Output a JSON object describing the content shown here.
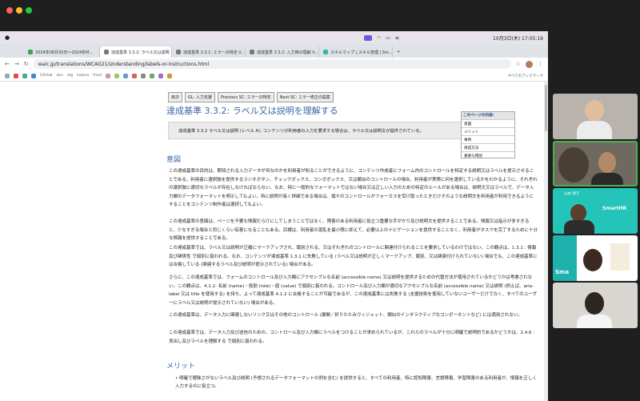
{
  "menubar": {
    "apple": "",
    "right_time": "10月3日(木) 17:05:19"
  },
  "tabs": [
    {
      "label": "2024年08月30日〜2024年M..."
    },
    {
      "label": "達成基準 3.3.2: ラベル又は説明"
    },
    {
      "label": "達成基準 3.3.1: エラーの特定 V..."
    },
    {
      "label": "達成基準 3.3.2: 入力時の理解 V..."
    },
    {
      "label": "スキルマップ | スキル管理 | Sm..."
    }
  ],
  "toolbar": {
    "url": "waic.jp/translations/WCAG21/Understanding/labels-or-instructions.html"
  },
  "bookmarks": {
    "items": [
      "GitHub",
      "dev",
      "otg",
      "kakuro",
      "front"
    ],
    "all": "すべてのブックマーク"
  },
  "nav": {
    "toc": "目次",
    "prev": "GL: 入力支援",
    "prev_sc": "Previous SC: エラーの特定",
    "next_sc": "Next SC: エラー修正の提案"
  },
  "page": {
    "title": "達成基準 3.3.2: ラベル又は説明を理解する",
    "summary": "達成基準 3.3.2 ラベル又は説明 (レベル A): コンテンツが利用者の入力を要求する場合は、ラベル又は説明文が提供されている。",
    "toc_title": "このページの内容:",
    "toc_items": [
      "意図",
      "メリット",
      "事例",
      "達成方法",
      "重要な用語"
    ],
    "intent_heading": "意図",
    "intent_p1": "この達成基準の目的は、期待される入力データが何なのかを利用者が知ることができるように、コンテンツ作成者にフォーム内のコントロールを特定する説明又はラベルを提示させることである。利用者に選択肢を提供するラジオボタン、チェックボックス、コンボボックス、又は類似のコントロールの場合、利用者が実際に何を選択しているかをわかるように、それぞれの選択肢に適切なラベルが存在しなければならない。なお、特に一般的なフォーマットではない場合又は正しい入力のための特定のルールがある場合は、説明文又はラベルで、データ入力欄のデータフォーマットを明示してもよい。特に説明が長く詳細である場合は、個々のコントロールがフォーカスを受け取ったときだけそのような説明文を利用者が利用できるようにすることをコンテンツ制作者は選択してもよい。",
    "intent_p2": "この達成基準の意図は、ページを不要な情報だらけにしてしまうことではなく、障害のある利用者に役立つ重要な手がかり及び説明文を提供することである。情報又は指示が多すぎると、少なすぎる場合と同じくらい有害になることもある。目標は、利用者の混乱を最小限に抑えて、必要以上のナビゲーションを提供することなく、利用者がタスクを完了するために十分な情報を提供することである。",
    "intent_p3": "この達成基準では、ラベル又は説明が正確にマークアップされ、識別される、又はそれぞれのコントロールに関連付けられることを要求しているわけではない。この観点は、1.3.1 : 情報及び関係性 で個別に扱われる。なお、コンテンツが達成基準 1.3.1 に失敗している (ラベル又は説明が正しくマークアップ、識別、又は関連付けられていない) 場合でも、この達成基準には合格している (関連するラベル及び説明が提示されている) 場合がある。",
    "intent_p4": "さらに、この達成基準では、フォームのコントロール及び入力欄にアクセシブルな名前 (accessible name) 又は説明を提供するための代替方法が使用されているかどうかは考慮されない。この観点は、4.1.2: 名前 (name)・役割 (role)・値 (value) で個別に扱われる。コントロール及び入力欄が適切なアクセシブルな名前 (accessible name) 又は説明 (例えば、aria-label 又は title を使用する) を持ち、よって達成基準 4.1.2 に合格することが可能であるが、この達成基準には失敗する (支援技術を使用していないユーザーだけでなく、すべてのユーザーにラベル又は説明が提示されていない) 場合がある。",
    "intent_p5": "この達成基準は、データ入力に関連しないリンク又はその他のコントロール (展開／折りたたみウィジェット、類似のインタラクティブなコンポーネントなど) には適用されない。",
    "intent_p6": "この達成基準では、データ入力及び送信のための、コントロール及び入力欄にラベルをつけることが求められているが、これらのラベルが十分に明確で説明的であるかどうかは、2.4.6 : 見出し及びラベルを理解する で個別に扱われる。",
    "merit_heading": "メリット",
    "merit_li1": "明確で曖昧さがないラベル及び説明 (予想されるデータフォーマットの例を含む) を提供すると、すべての利用者、特に認知障害、言語障害、学習障害のある利用者が、情報を正しく入力するのに役立つ。"
  },
  "video": {
    "tiles": [
      "person-1",
      "person-2",
      "shared-screen",
      "person-3",
      "person-4"
    ],
    "badge": "SmartHR",
    "tile3_text": "山本 翔子",
    "tile4_name": "Sma"
  }
}
